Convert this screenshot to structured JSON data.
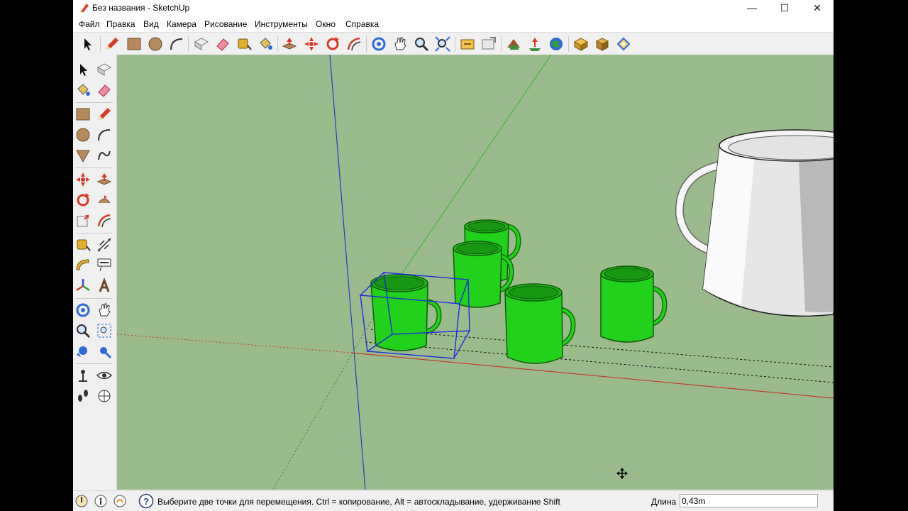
{
  "window": {
    "title": "Без названия - SketchUp",
    "minimize_label": "—",
    "maximize_label": "☐",
    "close_label": "✕"
  },
  "menu": [
    "Файл",
    "Правка",
    "Вид",
    "Камера",
    "Рисование",
    "Инструменты",
    "Окно",
    "Справка"
  ],
  "toolbar": {
    "tools": [
      "select-icon",
      "pencil-icon",
      "rectangle-icon",
      "circle-icon",
      "arc-icon",
      "make-component-icon",
      "eraser-icon",
      "tape-measure-icon",
      "paint-bucket-icon",
      "push-pull-icon",
      "move-icon",
      "rotate-icon",
      "offset-icon",
      "orbit-icon",
      "pan-icon",
      "zoom-icon",
      "zoom-extents-icon",
      "3d-warehouse-icon",
      "share-model-icon",
      "get-photo-texture-icon",
      "add-location-icon",
      "preview-in-earth-icon",
      "extension-warehouse-icon",
      "layout-icon",
      "style-builder-icon"
    ]
  },
  "status": {
    "message": "Выберите две точки для перемещения.  Ctrl = копирование, Alt = автоскладывание, удерживание Shift",
    "vcb_label": "Длина",
    "vcb_value": "0,43m"
  },
  "colors": {
    "viewport_bg": "#9bbb8d",
    "mug_green": "#22d11a",
    "axis_red": "#c23a2c",
    "axis_green": "#3bbd2e",
    "axis_blue": "#2a39c4",
    "selection_blue": "#1f2fd8"
  }
}
